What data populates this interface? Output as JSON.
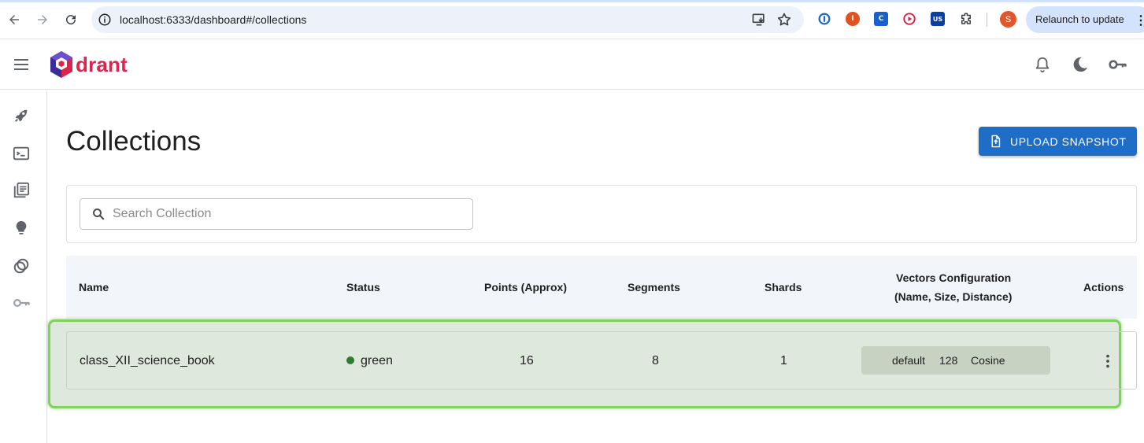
{
  "browser": {
    "url": "localhost:6333/dashboard#/collections",
    "avatar_letter": "S",
    "relaunch_label": "Relaunch to update",
    "extensions": [
      {
        "name": "1password",
        "label": ""
      },
      {
        "name": "ext-orange",
        "label": "I"
      },
      {
        "name": "ext-c",
        "label": "C"
      },
      {
        "name": "ext-play",
        "label": ""
      },
      {
        "name": "ext-us",
        "label": "US"
      }
    ]
  },
  "app": {
    "logo_text": "drant",
    "brand_color": "#dc244c",
    "accent_color": "#1e6ec8"
  },
  "page": {
    "title": "Collections",
    "upload_label": "UPLOAD SNAPSHOT",
    "search_placeholder": "Search Collection"
  },
  "table": {
    "headers": {
      "name": "Name",
      "status": "Status",
      "points": "Points (Approx)",
      "segments": "Segments",
      "shards": "Shards",
      "vectors_line1": "Vectors Configuration",
      "vectors_line2": "(Name, Size, Distance)",
      "actions": "Actions"
    },
    "rows": [
      {
        "name": "class_XII_science_book",
        "status": "green",
        "status_color": "#2e7d32",
        "points": "16",
        "segments": "8",
        "shards": "1",
        "vector_name": "default",
        "vector_size": "128",
        "vector_distance": "Cosine"
      }
    ]
  }
}
